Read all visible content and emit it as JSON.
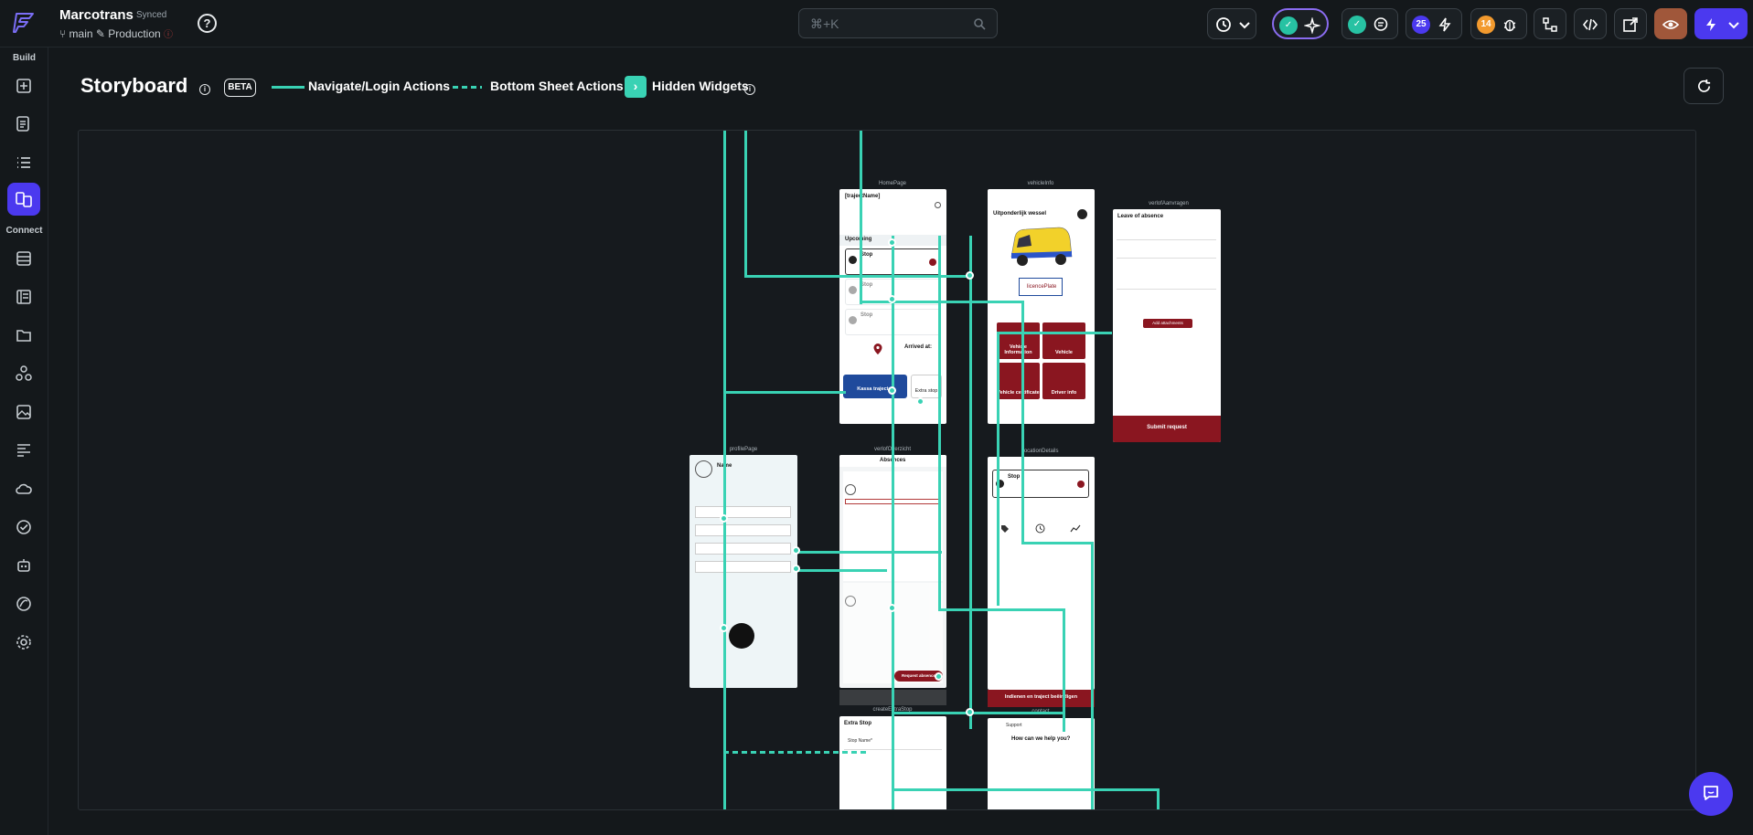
{
  "topbar": {
    "project_name": "Marcotrans",
    "sync_status": "Synced",
    "branch": "main",
    "environment": "Production",
    "search_placeholder": "⌘+K",
    "badge_a": "25",
    "badge_b": "14"
  },
  "sidebar": {
    "section_build": "Build",
    "section_connect": "Connect"
  },
  "storyboard": {
    "title": "Storyboard",
    "beta_label": "BETA",
    "legend_navigate": "Navigate/Login Actions",
    "legend_bottom_sheet": "Bottom Sheet Actions",
    "legend_hidden": "Hidden Widgets"
  },
  "pages": {
    "homepage": {
      "label": "HomePage",
      "header": "[trajectName]",
      "section": "Upcoming",
      "stop": "Stop",
      "arrived": "Arrived at:",
      "change_button": "Kassa trajecter",
      "extra_stop": "Extra stop"
    },
    "vehicleinfo": {
      "label": "vehicleInfo",
      "vehicle_title": "Uitponderlijk wessel",
      "plate": "licencePlate",
      "tile_1": "Vehicle Information",
      "tile_2": "Vehicle",
      "tile_3": "Vehicle certificate",
      "tile_4": "Driver info"
    },
    "leave": {
      "label": "verlofAanvragen",
      "title": "Leave of absence",
      "add_btn": "Add attachments",
      "submit": "Submit request"
    },
    "profile": {
      "label": "profilePage",
      "name": "Name"
    },
    "absences": {
      "label": "verlofOverzicht",
      "title": "Absences",
      "request_btn": "Request absence"
    },
    "location": {
      "label": "locationDetails",
      "stop": "Stop",
      "submit": "Indienen en traject beëindigen"
    },
    "extrastop": {
      "label": "createExtraStop",
      "title": "Extra Stop",
      "field": "Stop Name*"
    },
    "contact": {
      "label": "contact",
      "title": "Support",
      "question": "How can we help you?"
    }
  }
}
